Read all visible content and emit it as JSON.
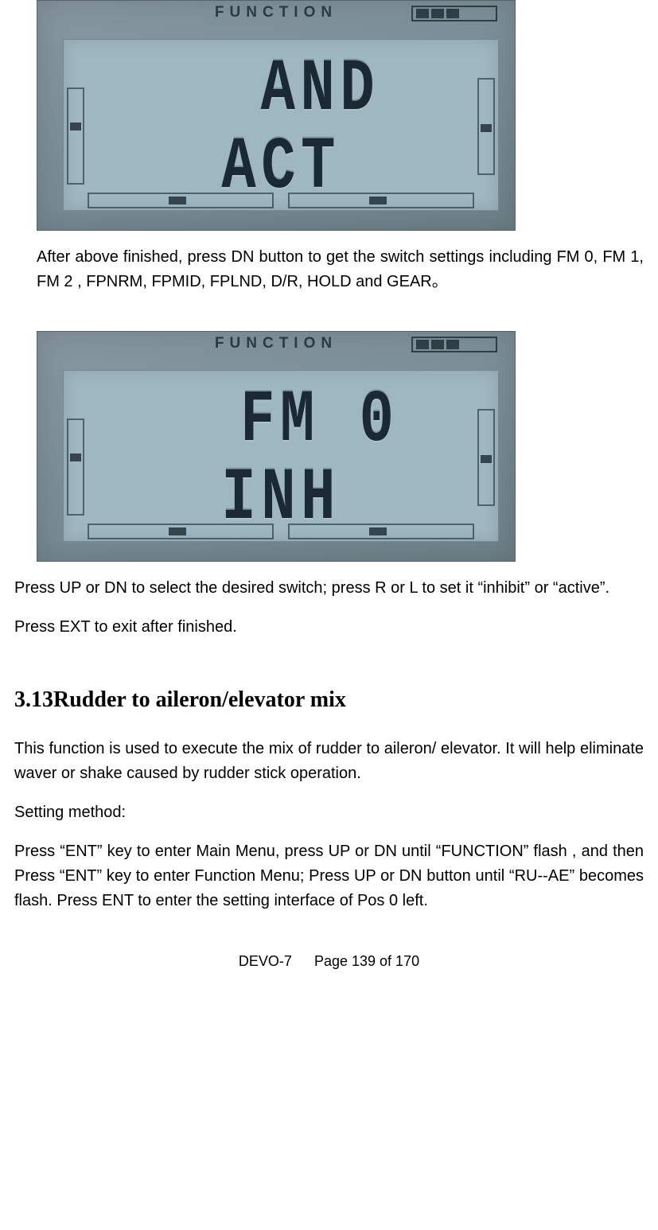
{
  "screen1": {
    "label": "FUNCTION",
    "line1": "AND",
    "line2": "ACT"
  },
  "paragraph1": "After above finished, press DN button to get the switch settings including FM 0, FM 1, FM 2 , FPNRM, FPMID, FPLND, D/R, HOLD and GEAR。",
  "screen2": {
    "label": "FUNCTION",
    "line1": "FM 0",
    "line2": "INH"
  },
  "paragraph2": "Press UP or DN to select the desired switch; press R or L to set it “inhibit” or “active”.",
  "paragraph3": "Press EXT to exit after finished.",
  "section_heading": "3.13Rudder to aileron/elevator mix",
  "paragraph4": "This function is used to execute the mix of rudder to aileron/ elevator. It will help eliminate waver or shake caused by rudder stick operation.",
  "paragraph5": "Setting method:",
  "paragraph6": "Press “ENT” key to enter Main Menu, press UP or DN until “FUNCTION” flash , and then Press “ENT” key to enter Function Menu; Press UP or DN button until “RU--AE” becomes flash. Press ENT to enter the setting interface of Pos 0 left.",
  "footer": {
    "model": "DEVO-7",
    "page_info": "Page 139 of 170"
  }
}
